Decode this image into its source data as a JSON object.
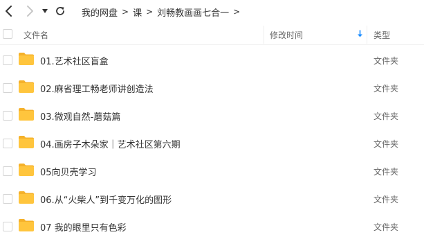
{
  "breadcrumb": {
    "items": [
      "我的网盘",
      "课",
      "刘畅教画画七合一"
    ],
    "separator": ">"
  },
  "table": {
    "headers": {
      "name": "文件名",
      "modified": "修改时间",
      "type": "类型"
    },
    "sort": {
      "column": "modified",
      "direction": "descending",
      "icon": "sort-down-arrow-icon"
    },
    "rows": [
      {
        "name": "01.艺术社区盲盒",
        "type": "文件夹"
      },
      {
        "name": "02.麻省理工畅老师讲创造法",
        "type": "文件夹"
      },
      {
        "name": "03.微观自然-蘑菇篇",
        "type": "文件夹"
      },
      {
        "name": "04.画房子木朵家｜艺术社区第六期",
        "type": "文件夹"
      },
      {
        "name": "05向贝壳学习",
        "type": "文件夹"
      },
      {
        "name": "06.从“火柴人”到千变万化的图形",
        "type": "文件夹"
      },
      {
        "name": "07 我的眼里只有色彩",
        "type": "文件夹"
      }
    ]
  },
  "colors": {
    "folder": "#ffc53d",
    "folder_tab": "#f5b12a",
    "accent": "#1a8cff",
    "text": "#333333",
    "muted": "#666666",
    "disabled": "#c8c8c8"
  },
  "icons": {
    "back": "chevron-left-icon",
    "forward": "chevron-right-icon",
    "history": "caret-down-icon",
    "refresh": "refresh-icon",
    "folder": "folder-icon"
  }
}
